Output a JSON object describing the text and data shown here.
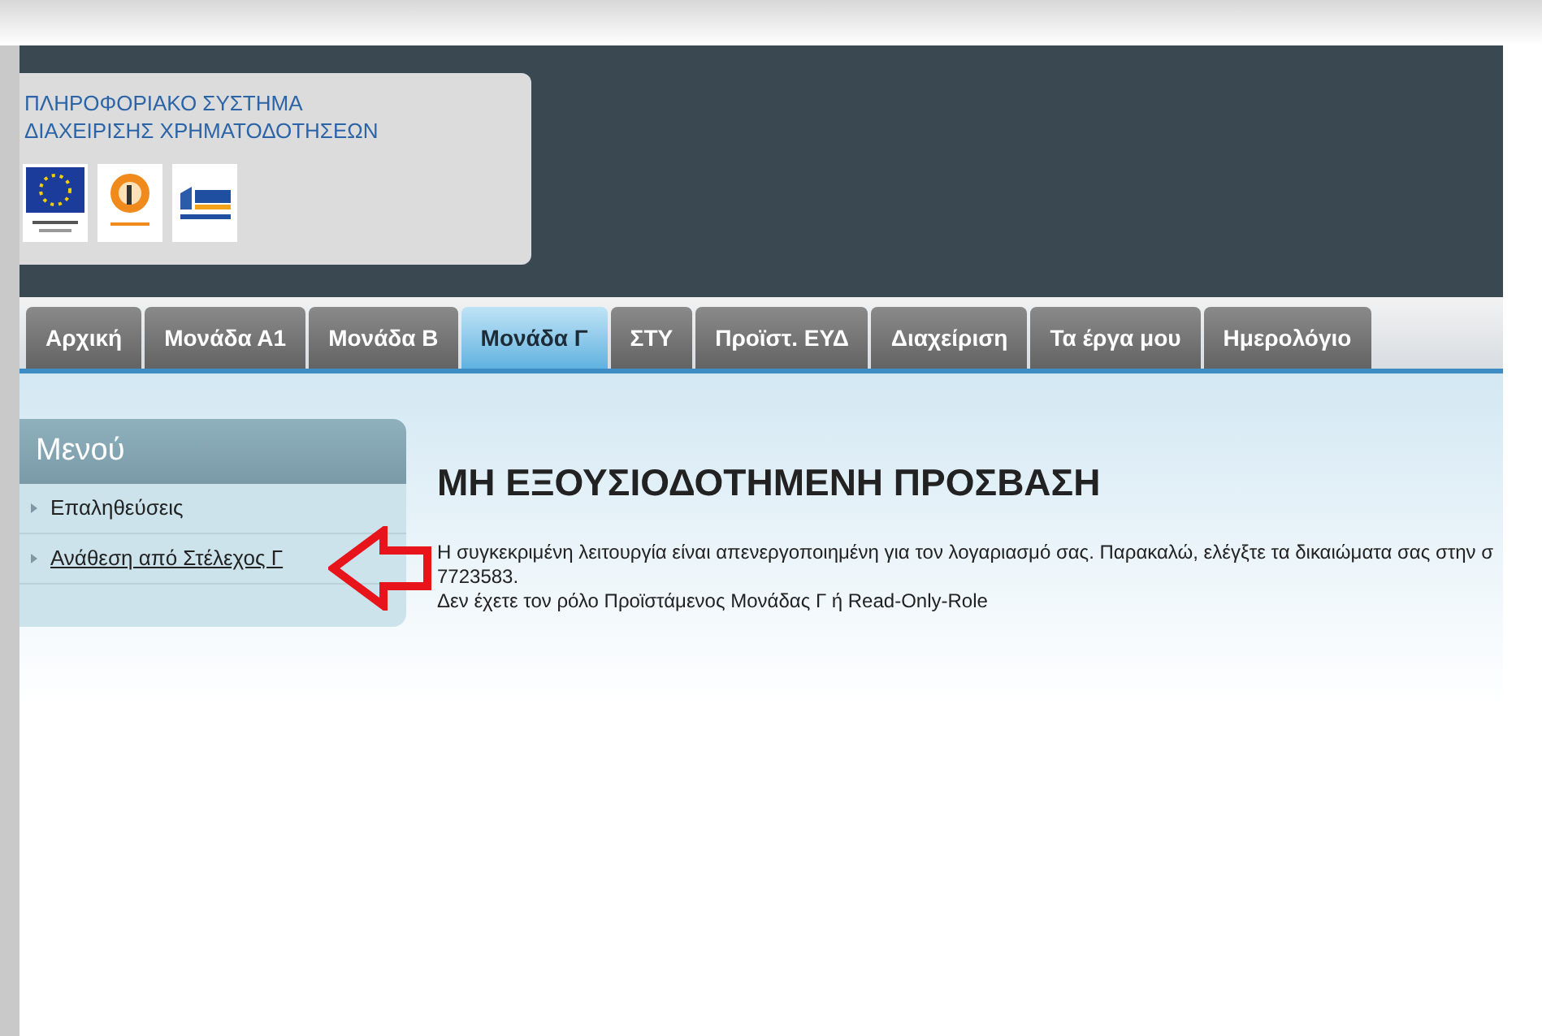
{
  "header": {
    "title_lines": [
      "ΠΛΗΡΟΦΟΡΙΑΚΟ ΣΥΣΤΗΜΑ",
      "ΔΙΑΧΕΙΡΙΣΗΣ ΧΡΗΜΑΤΟΔΟΤΗΣΕΩΝ"
    ]
  },
  "tabs": [
    {
      "label": "Αρχική",
      "selected": false
    },
    {
      "label": "Μονάδα Α1",
      "selected": false
    },
    {
      "label": "Μονάδα Β",
      "selected": false
    },
    {
      "label": "Μονάδα Γ",
      "selected": true
    },
    {
      "label": "ΣΤΥ",
      "selected": false
    },
    {
      "label": "Προϊστ. ΕΥΔ",
      "selected": false
    },
    {
      "label": "Διαχείριση",
      "selected": false
    },
    {
      "label": "Τα έργα μου",
      "selected": false
    },
    {
      "label": "Ημερολόγιο",
      "selected": false
    }
  ],
  "menu": {
    "title": "Μενού",
    "items": [
      {
        "label": "Επαληθεύσεις",
        "kind": "plain"
      },
      {
        "label": "Ανάθεση από Στέλεχος Γ",
        "kind": "link"
      }
    ]
  },
  "content": {
    "heading": "ΜΗ ΕΞΟΥΣΙΟΔΟΤΗΜΕΝΗ ΠΡΟΣΒΑΣΗ",
    "lines": [
      "Η συγκεκριμένη λειτουργία είναι απενεργοποιημένη για τον λογαριασμό σας. Παρακαλώ, ελέγξτε τα δικαιώματα σας στην σ",
      "7723583.",
      "Δεν έχετε τον ρόλο Προϊστάμενος Μονάδας Γ ή Read-Only-Role"
    ]
  }
}
